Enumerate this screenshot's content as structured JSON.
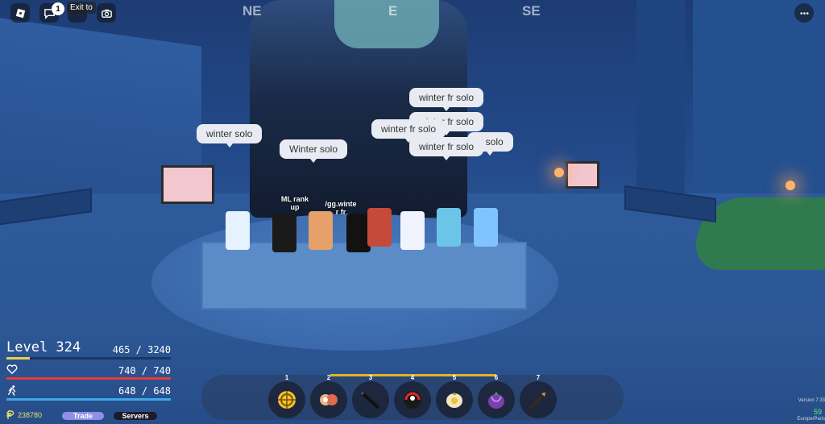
{
  "compass": {
    "ne": "NE",
    "e": "E",
    "se": "SE"
  },
  "topbar": {
    "notification_count": "1",
    "tooltip": "Exit to"
  },
  "chat_bubbles": [
    "winter solo",
    "Winter solo",
    "winter fr solo",
    "winter fr solo",
    "fr solo",
    "winter fr solo",
    "winter fr solo"
  ],
  "nametags": {
    "ml": "ML rank\nup",
    "gg": "/gg.winte\nr fr"
  },
  "stats": {
    "level_label": "Level 324",
    "xp": "465 / 3240",
    "xp_fraction": 0.1435,
    "health": "740 / 740",
    "health_fraction": 1.0,
    "energy": "648 / 648",
    "energy_fraction": 1.0,
    "colors": {
      "xp": "#e8d04a",
      "health": "#e53b3b",
      "energy": "#3da9e8"
    }
  },
  "currency": "238780",
  "buttons": {
    "trade": "Trade",
    "servers": "Servers"
  },
  "hotbar": {
    "slots": [
      {
        "num": "1",
        "icon": "compass-fruit-icon"
      },
      {
        "num": "2",
        "icon": "fist-style-icon"
      },
      {
        "num": "3",
        "icon": "dark-blade-icon"
      },
      {
        "num": "4",
        "icon": "red-dragon-fruit-icon"
      },
      {
        "num": "5",
        "icon": "sun-fruit-icon"
      },
      {
        "num": "6",
        "icon": "purple-fruit-icon"
      },
      {
        "num": "7",
        "icon": "spear-icon"
      }
    ]
  },
  "footer": {
    "version": "Version 7.33",
    "fps": "59",
    "region": "Europe/Paris"
  }
}
